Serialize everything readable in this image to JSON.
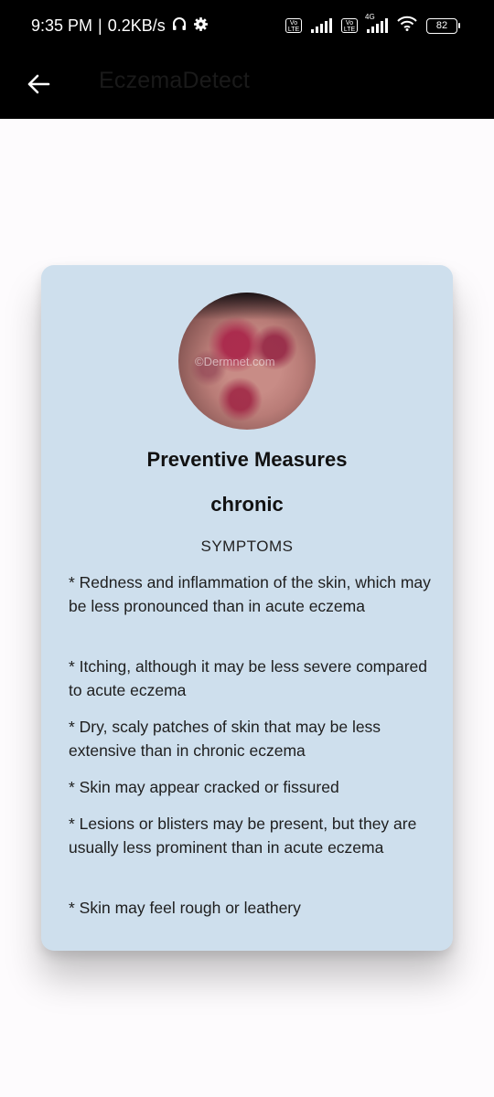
{
  "status_bar": {
    "time": "9:35 PM",
    "speed": "0.2KB/s",
    "sim1_badge": "Vo LTE",
    "sim2_badge": "Vo LTE",
    "network_type": "4G",
    "battery_level": "82"
  },
  "app_bar": {
    "title": "EczemaDetect",
    "back_icon": "arrow-left-icon"
  },
  "card": {
    "image_watermark": "©Dermnet.com",
    "title": "Preventive Measures",
    "eczema_type": "chronic",
    "section_label": "SYMPTOMS",
    "symptoms": [
      "* Redness and inflammation of the skin, which may be less pronounced than in acute eczema",
      "* Itching, although it may be less severe compared to acute eczema",
      "* Dry, scaly patches of skin that may be less extensive than in chronic eczema",
      "* Skin may appear cracked or fissured",
      "*  Lesions or blisters may be present, but they are usually less prominent than in acute eczema",
      "* Skin may feel rough or leathery"
    ]
  }
}
